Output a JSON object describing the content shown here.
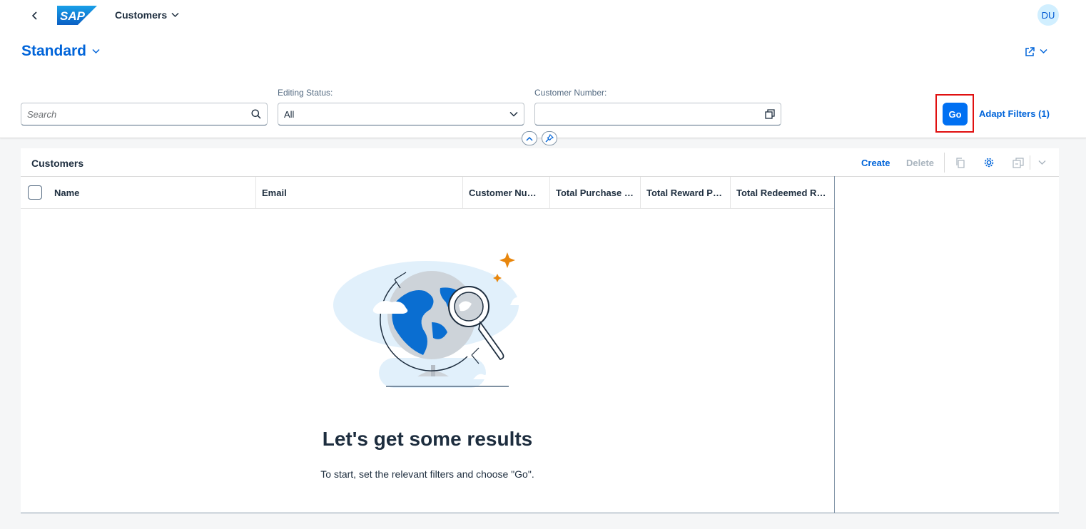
{
  "shell": {
    "logo_text": "SAP",
    "app_title": "Customers",
    "avatar_initials": "DU"
  },
  "header": {
    "variant_name": "Standard"
  },
  "filters": {
    "search_placeholder": "Search",
    "editing_status_label": "Editing Status:",
    "editing_status_value": "All",
    "customer_number_label": "Customer Number:",
    "customer_number_value": "",
    "go_label": "Go",
    "adapt_filters_label": "Adapt Filters (1)"
  },
  "table": {
    "title": "Customers",
    "create_label": "Create",
    "delete_label": "Delete",
    "columns": [
      "Name",
      "Email",
      "Customer Number",
      "Total Purchase Value",
      "Total Reward Points",
      "Total Redeemed Rewards"
    ],
    "empty_title": "Let's get some results",
    "empty_description": "To start, set the relevant filters and choose \"Go\"."
  },
  "colors": {
    "accent": "#0070f2",
    "link": "#0064d9",
    "highlight": "#e01010",
    "star": "#e8860c"
  }
}
